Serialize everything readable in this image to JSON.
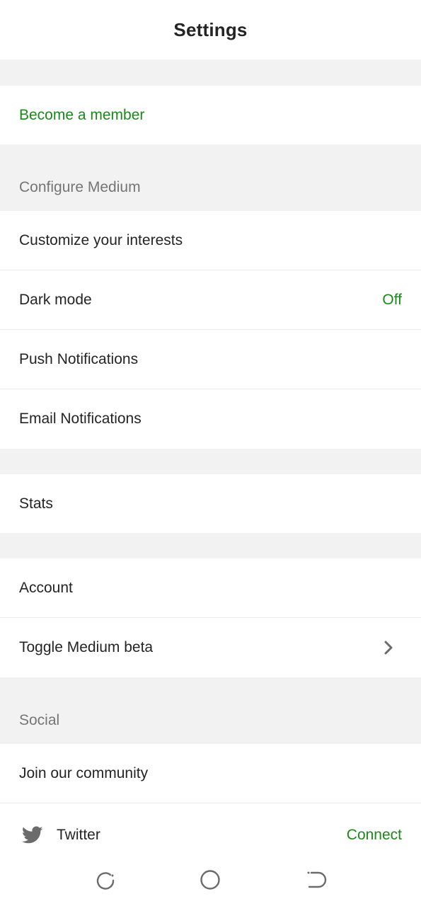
{
  "header": {
    "title": "Settings"
  },
  "membership": {
    "label": "Become a member"
  },
  "configure": {
    "header": "Configure Medium",
    "items": [
      {
        "label": "Customize your interests"
      },
      {
        "label": "Dark mode",
        "value": "Off"
      },
      {
        "label": "Push Notifications"
      },
      {
        "label": "Email Notifications"
      }
    ]
  },
  "stats": {
    "label": "Stats"
  },
  "account": {
    "items": [
      {
        "label": "Account"
      },
      {
        "label": "Toggle Medium beta",
        "icon": "chevron-right-icon"
      }
    ]
  },
  "social": {
    "header": "Social",
    "items": [
      {
        "label": "Join our community"
      },
      {
        "label": "Twitter",
        "icon": "twitter-icon",
        "action": "Connect"
      }
    ]
  },
  "navbar": {
    "icons": [
      "recent-apps-icon",
      "home-icon",
      "back-icon"
    ]
  },
  "colors": {
    "accent": "#1a8917",
    "text": "#242424",
    "muted": "#757575",
    "band": "#f2f2f2"
  }
}
